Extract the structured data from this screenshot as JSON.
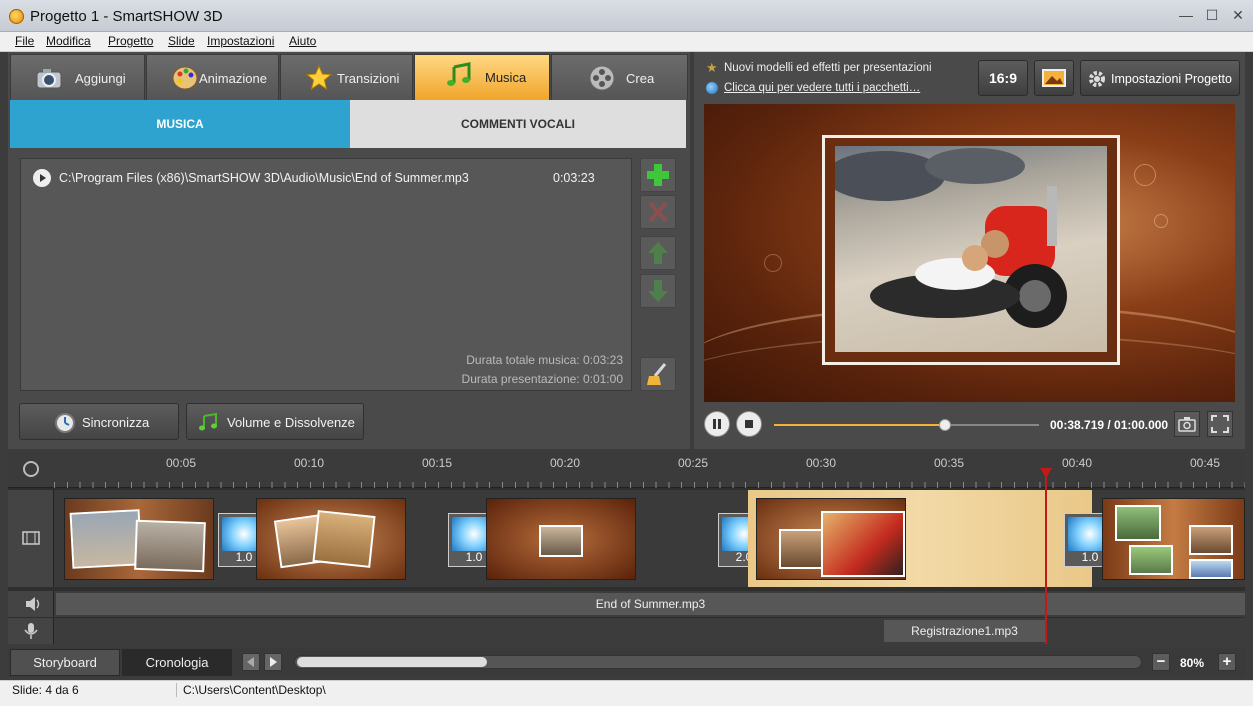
{
  "window": {
    "title": "Progetto 1 - SmartSHOW 3D",
    "minimize": "—",
    "maximize": "☐",
    "close": "✕"
  },
  "menu": [
    "File",
    "Modifica",
    "Progetto",
    "Slide",
    "Impostazioni",
    "Aiuto"
  ],
  "tabs": [
    {
      "label": "Aggiungi"
    },
    {
      "label": "Animazione"
    },
    {
      "label": "Transizioni"
    },
    {
      "label": "Musica",
      "active": true
    },
    {
      "label": "Crea"
    }
  ],
  "subtabs": {
    "music": "MUSICA",
    "voice": "COMMENTI VOCALI"
  },
  "music_list": {
    "items": [
      {
        "path": "C:\\Program Files (x86)\\SmartSHOW 3D\\Audio\\Music\\End of Summer.mp3",
        "duration": "0:03:23"
      }
    ],
    "total": "Durata totale musica: 0:03:23",
    "presentation": "Durata presentazione: 0:01:00"
  },
  "buttons": {
    "sync": "Sincronizza",
    "volume": "Volume e Dissolvenze"
  },
  "promo": {
    "text": "Nuovi modelli ed effetti per presentazioni",
    "link": "Clicca qui per vedere tutti i pacchetti…"
  },
  "toolbar": {
    "ratio": "16:9",
    "settings": "Impostazioni Progetto"
  },
  "player": {
    "timecode": "00:38.719 / 01:00.000",
    "progress": 0.645
  },
  "ruler": [
    "00:05",
    "00:10",
    "00:15",
    "00:20",
    "00:25",
    "00:30",
    "00:35",
    "00:40",
    "00:45"
  ],
  "transitions": [
    "1.0",
    "1.0",
    "2.0",
    "1.0"
  ],
  "tracks": {
    "music": "End of Summer.mp3",
    "voice": "Registrazione1.mp3"
  },
  "bottom": {
    "storyboard": "Storyboard",
    "timeline": "Cronologia",
    "zoom": "80%",
    "zoom_minus": "−",
    "zoom_plus": "+"
  },
  "status": {
    "slide": "Slide: 4 da 6",
    "path": "C:\\Users\\Content\\Desktop\\"
  },
  "colors": {
    "accent": "#2fa3cf",
    "active_tab": "#f0a52a",
    "playhead": "#c21a1a",
    "seek": "#f4b23a"
  }
}
